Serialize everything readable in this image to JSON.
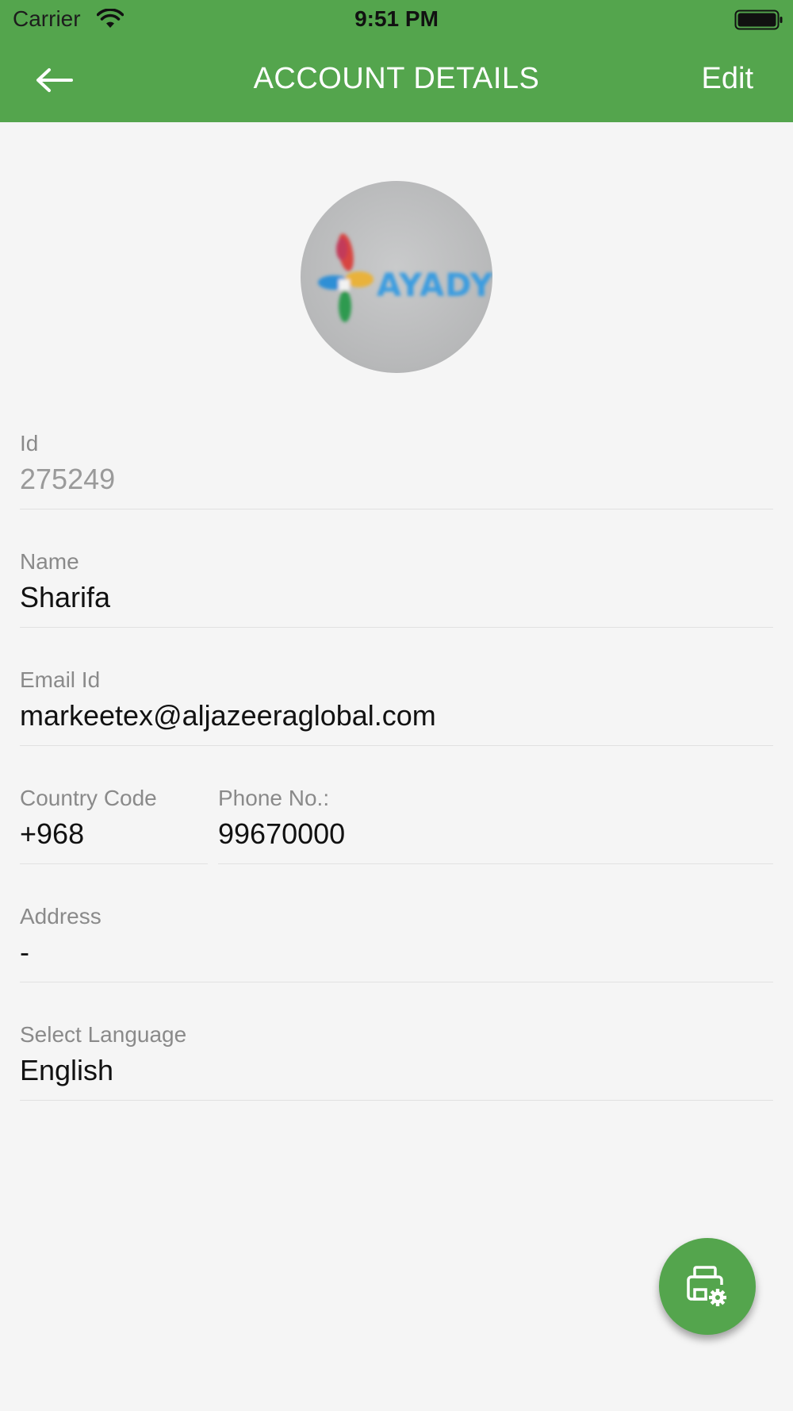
{
  "status_bar": {
    "carrier": "Carrier",
    "time": "9:51 PM",
    "icons": [
      "wifi-icon",
      "battery-icon"
    ]
  },
  "header": {
    "title": "ACCOUNT DETAILS",
    "edit_label": "Edit",
    "back_icon": "arrow-left-icon",
    "background_color": "#54a54d"
  },
  "avatar": {
    "logo_text": "AYADY"
  },
  "fields": {
    "id": {
      "label": "Id",
      "value": "275249"
    },
    "name": {
      "label": "Name",
      "value": "Sharifa"
    },
    "email": {
      "label": "Email Id",
      "value": "markeetex@aljazeeraglobal.com"
    },
    "country_code": {
      "label": "Country Code",
      "value": "+968"
    },
    "phone": {
      "label": "Phone No.:",
      "value": "99670000"
    },
    "address": {
      "label": "Address",
      "value": "-"
    },
    "language": {
      "label": "Select Language",
      "value": "English"
    }
  },
  "fab": {
    "icon": "printer-settings-icon",
    "color": "#54a54d"
  }
}
